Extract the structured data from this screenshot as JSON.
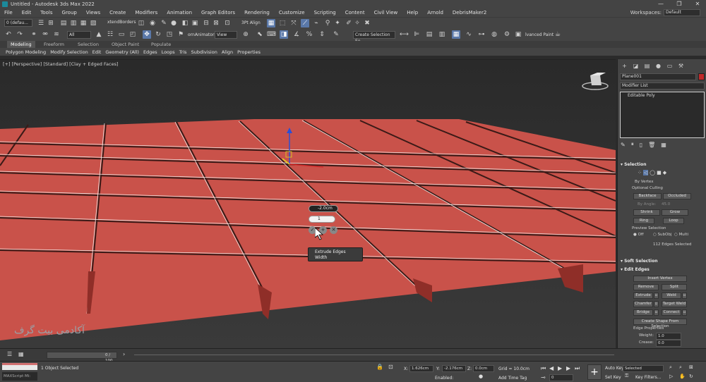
{
  "window": {
    "title": "Untitled - Autodesk 3ds Max 2022",
    "minimize": "—",
    "maximize": "❐",
    "close": "✕"
  },
  "menu": [
    "File",
    "Edit",
    "Tools",
    "Group",
    "Views",
    "Create",
    "Modifiers",
    "Animation",
    "Graph Editors",
    "Rendering",
    "Customize",
    "Scripting",
    "Content",
    "Civil View",
    "Help",
    "Arnold",
    "DebrisMaker2"
  ],
  "workspaces": {
    "label": "Workspaces:",
    "value": "Default"
  },
  "toolbar": {
    "layer_field": "0 (defau...",
    "filter": "All",
    "extend_borders": "xtendBorders",
    "shortcut_field": "ornAnimators",
    "view": "View",
    "three_pt_align": "3Pt Align",
    "selection_set": "Create Selection Se",
    "advanced_paint": "lvanced Paint"
  },
  "ribbon": {
    "tabs": [
      "Modeling",
      "Freeform",
      "Selection",
      "Object Paint",
      "Populate"
    ],
    "sub_items": [
      "Polygon Modeling",
      "Modify Selection",
      "Edit",
      "Geometry (All)",
      "Edges",
      "Loops",
      "Tris",
      "Subdivision",
      "Align",
      "Properties"
    ]
  },
  "viewport": {
    "label": "[+] [Perspective] [Standard] [Clay + Edged Faces]",
    "watermark": "آکادمی بیت گرف",
    "caddy": {
      "title": "Extrude Edges",
      "subtitle": "Width",
      "height_value": "-2.0cm",
      "width_value": "1",
      "ok": "✓",
      "apply": "+",
      "cancel": "✕"
    }
  },
  "command_panel": {
    "object_name": "Plane001",
    "object_color": "#c02a2a",
    "modifier_list": "Modifier List",
    "stack_item": "Editable Poly",
    "selection": {
      "title": "Selection",
      "by_vertex": "By Vertex",
      "optional_culling": "Optional Culling",
      "backface": "Backface",
      "occluded": "Occluded",
      "by_angle": "By Angle:",
      "angle_value": "45.0",
      "shrink": "Shrink",
      "grow": "Grow",
      "ring": "Ring",
      "loop": "Loop",
      "preview_selection": "Preview Selection",
      "preview_off": "Off",
      "preview_subobj": "SubObj",
      "preview_multi": "Multi",
      "selected_count": "112 Edges Selected"
    },
    "soft_selection": {
      "title": "Soft Selection"
    },
    "edit_edges": {
      "title": "Edit Edges",
      "insert_vertex": "Insert Vertex",
      "remove": "Remove",
      "split": "Split",
      "extrude": "Extrude",
      "weld": "Weld",
      "chamfer": "Chamfer",
      "target_weld": "Target Weld",
      "bridge": "Bridge",
      "connect": "Connect",
      "create_shape": "Create Shape From Selection",
      "edge_properties": "Edge Properties",
      "weight_label": "Weight:",
      "weight_value": "1.0",
      "crease_label": "Crease:",
      "crease_value": "0.0"
    }
  },
  "timeline": {
    "frame": "0 / 100"
  },
  "status": {
    "maxscript": "MAXScript Mi:",
    "selection_info": "1 Object Selected",
    "x_label": "X:",
    "x_value": "1.626cm",
    "y_label": "Y:",
    "y_value": "-2.176cm",
    "z_label": "Z:",
    "z_value": "0.0cm",
    "grid": "Grid = 10.0cm",
    "enabled": "Enabled:",
    "add_time_tag": "Add Time Tag",
    "auto_key": "Auto Key",
    "selected": "Selected",
    "set_key": "Set Key",
    "key_filters": "Key Filters...",
    "frame_field": "0"
  }
}
